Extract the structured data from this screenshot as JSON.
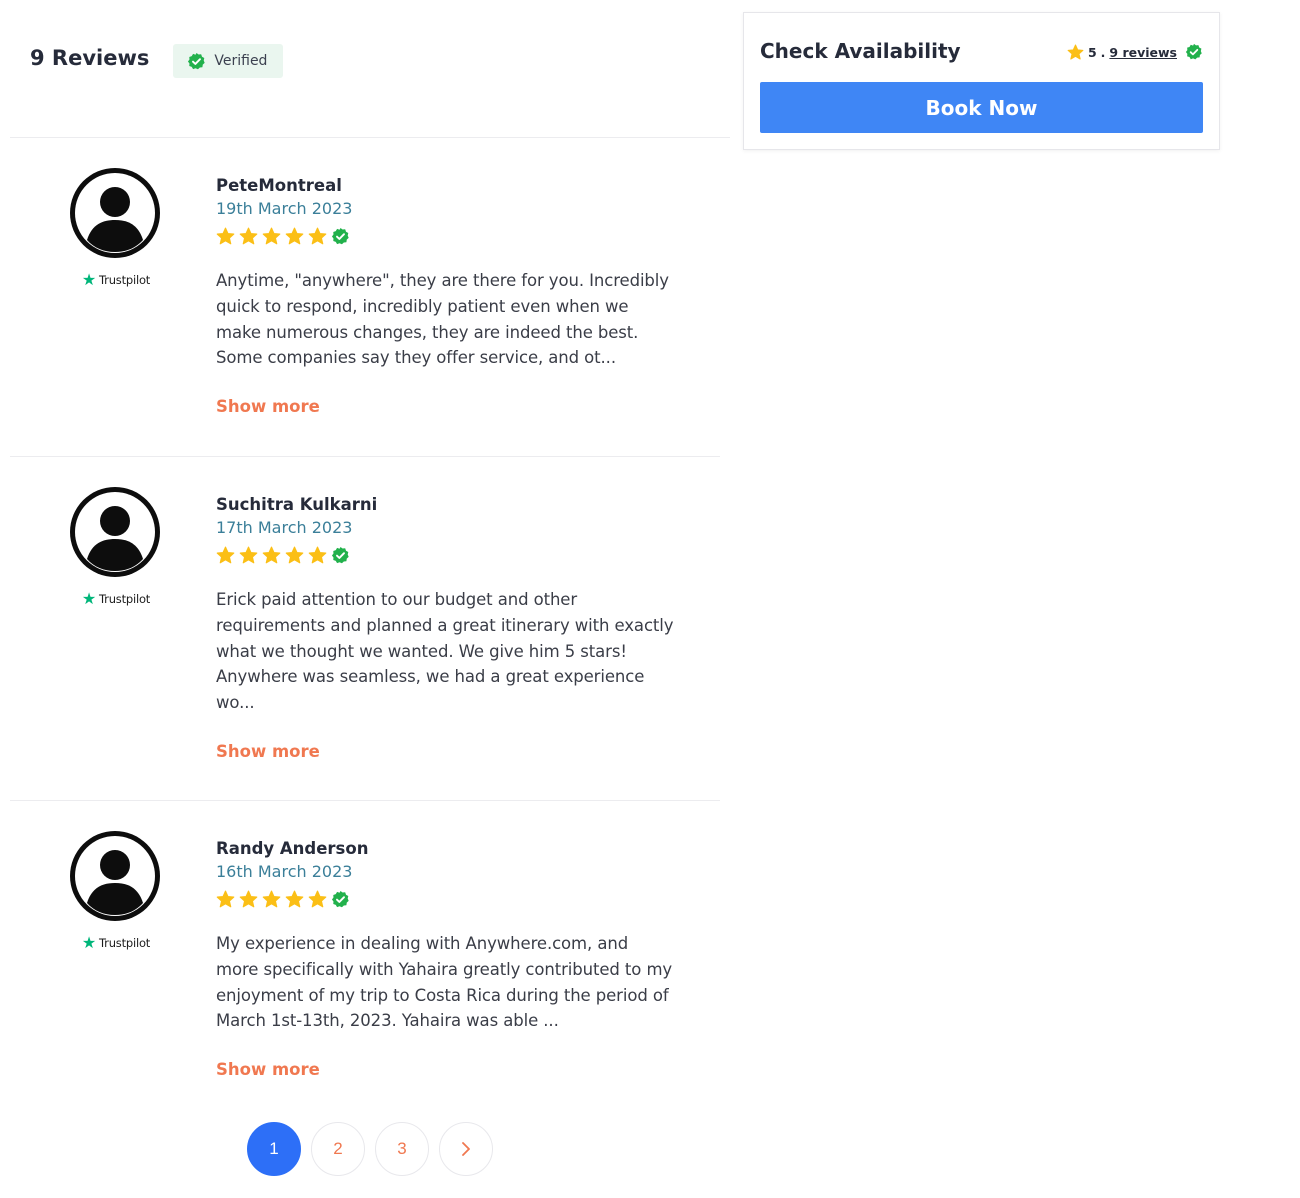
{
  "reviews_header": {
    "count_label": "9 Reviews",
    "verified_label": "Verified"
  },
  "reviews": [
    {
      "name": "PeteMontreal",
      "date": "19th March 2023",
      "rating": 5,
      "source": "Trustpilot",
      "text": "Anytime, \"anywhere\", they are there for you. Incredibly\nquick to respond, incredibly patient even when we\nmake numerous changes, they are indeed the best.\nSome companies say they offer service, and ot...",
      "show_more": "Show more"
    },
    {
      "name": "Suchitra Kulkarni",
      "date": "17th March 2023",
      "rating": 5,
      "source": "Trustpilot",
      "text": "Erick paid attention to our budget and other\nrequirements and planned a great itinerary with exactly\nwhat we thought we wanted. We give him 5 stars!\nAnywhere was seamless, we had a great experience\nwo...",
      "show_more": "Show more"
    },
    {
      "name": "Randy Anderson",
      "date": "16th March 2023",
      "rating": 5,
      "source": "Trustpilot",
      "text": "My experience in dealing with Anywhere.com, and\nmore specifically with Yahaira greatly contributed to my\nenjoyment of my trip to Costa Rica during the period of\nMarch 1st-13th, 2023. Yahaira was able ...",
      "show_more": "Show more"
    }
  ],
  "pagination": {
    "pages": [
      "1",
      "2",
      "3"
    ],
    "active": "1",
    "next_icon": "chevron-right-icon"
  },
  "availability": {
    "title": "Check Availability",
    "rating_value": "5",
    "separator": ".",
    "reviews_link": "9 reviews",
    "book_label": "Book Now"
  },
  "colors": {
    "accent_blue": "#3f86f5",
    "active_page": "#2d6ff7",
    "show_more": "#f07850",
    "star": "#fbbf16",
    "verified_green": "#22b14c",
    "date": "#3b7f99",
    "trustpilot_green": "#00b67a"
  }
}
